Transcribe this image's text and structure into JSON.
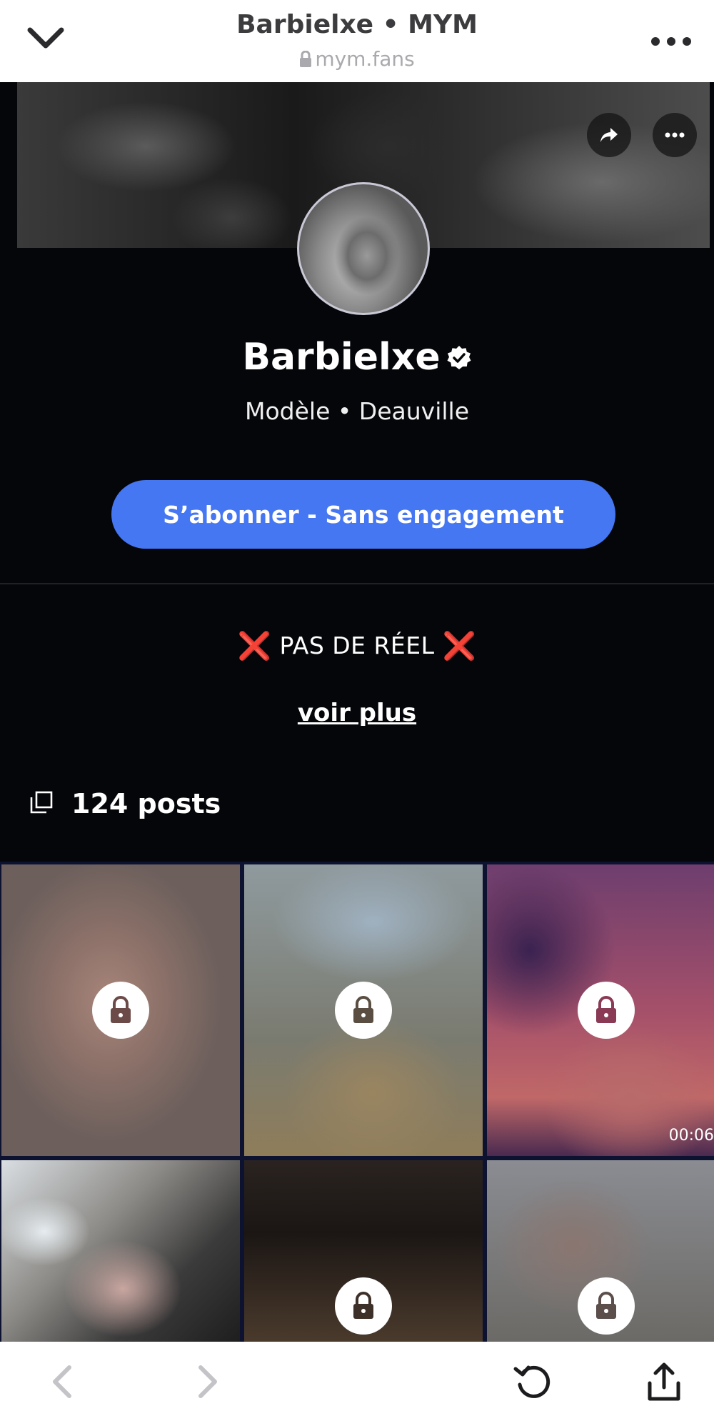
{
  "browser": {
    "title": "Barbielxe • MYM",
    "url": "mym.fans"
  },
  "profile": {
    "name": "Barbielxe",
    "subtitle": "Modèle • Deauville",
    "subscribe_label": "S’abonner - Sans engagement",
    "bio": "PAS DE RÉEL",
    "bio_emoji": "❌",
    "more_label": "voir plus",
    "posts_label": "124 posts"
  },
  "grid": {
    "video_duration": "00:06"
  },
  "colors": {
    "accent": "#4577f3",
    "background": "#05060a",
    "bio_x": "#e0414f"
  },
  "icons": {
    "top_left": "chevron-down-icon",
    "top_right": "more-horizontal-icon",
    "banner_share": "share-arrow-icon",
    "banner_more": "more-horizontal-icon",
    "verified": "verified-badge-icon",
    "posts": "stack-icon",
    "locked_tile": "lock-icon",
    "nav_back": "chevron-left-icon",
    "nav_forward": "chevron-right-icon",
    "nav_reload": "reload-icon",
    "nav_share": "share-icon"
  }
}
